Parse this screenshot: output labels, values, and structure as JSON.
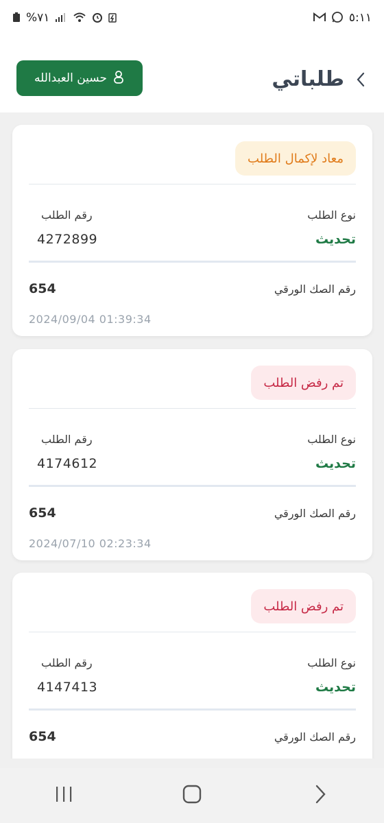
{
  "status_bar": {
    "time": "٥:١١",
    "battery": "%٧١"
  },
  "header": {
    "title": "طلباتي",
    "user_name": "حسين العبدالله"
  },
  "labels": {
    "request_type": "نوع الطلب",
    "request_number": "رقم الطلب",
    "paper_deed_number": "رقم الصك الورقي"
  },
  "requests": [
    {
      "status": "معاد لإكمال الطلب",
      "status_color": "#e07b1a",
      "type": "تحديث",
      "number": "4272899",
      "deed_number": "654",
      "date": "2024/09/04 01:39:34"
    },
    {
      "status": "تم رفض الطلب",
      "status_color": "#c62845",
      "type": "تحديث",
      "number": "4174612",
      "deed_number": "654",
      "date": "2024/07/10 02:23:34"
    },
    {
      "status": "تم رفض الطلب",
      "status_color": "#c62845",
      "type": "تحديث",
      "number": "4147413",
      "deed_number": "654",
      "date": ""
    }
  ],
  "colors": {
    "brand_green": "#1f7a45",
    "title_gray": "#3c4654"
  },
  "icons": {
    "back": "chevron-right-icon",
    "user": "user-icon",
    "nav_recents": "recents-icon",
    "nav_home": "home-icon",
    "nav_back": "nav-back-icon"
  }
}
